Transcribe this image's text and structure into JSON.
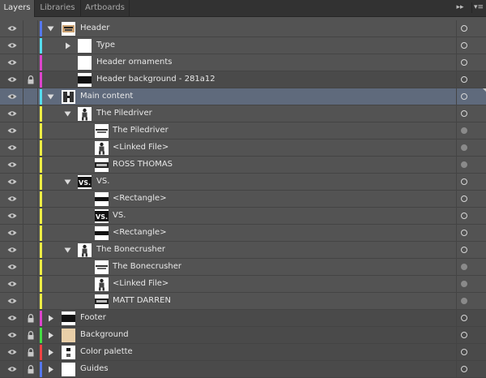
{
  "tabs": [
    "Layers",
    "Libraries",
    "Artboards"
  ],
  "layers": [
    {
      "name": "Header",
      "depth": 0,
      "color": "#5577ee",
      "expand": "open",
      "thumb": "header",
      "locked": false,
      "target_filled": false
    },
    {
      "name": "Type",
      "depth": 1,
      "color": "#55ddee",
      "expand": "closed",
      "thumb": "blank",
      "locked": false,
      "target_filled": false
    },
    {
      "name": "Header ornaments",
      "depth": 1,
      "color": "#dd44cc",
      "expand": "none",
      "thumb": "blank",
      "locked": false,
      "target_filled": false
    },
    {
      "name": "Header background - 281a12",
      "depth": 1,
      "color": "#dd44cc",
      "expand": "none",
      "thumb": "band",
      "locked": true,
      "target_filled": false
    },
    {
      "name": "Main content",
      "depth": 0,
      "color": "#55ddee",
      "expand": "open",
      "thumb": "main",
      "locked": false,
      "target_filled": false,
      "selected": true
    },
    {
      "name": "The Piledriver",
      "depth": 1,
      "color": "#eeee44",
      "expand": "open",
      "thumb": "figure",
      "locked": false,
      "target_filled": false
    },
    {
      "name": "The Piledriver",
      "depth": 2,
      "color": "#eeee44",
      "expand": "none",
      "thumb": "title",
      "locked": false,
      "target_filled": true
    },
    {
      "name": "<Linked File>",
      "depth": 2,
      "color": "#eeee44",
      "expand": "none",
      "thumb": "figure",
      "locked": false,
      "target_filled": true
    },
    {
      "name": "ROSS THOMAS",
      "depth": 2,
      "color": "#eeee44",
      "expand": "none",
      "thumb": "name",
      "locked": false,
      "target_filled": true
    },
    {
      "name": "VS.",
      "depth": 1,
      "color": "#eeee44",
      "expand": "open",
      "thumb": "vs",
      "locked": false,
      "target_filled": false
    },
    {
      "name": "<Rectangle>",
      "depth": 2,
      "color": "#eeee44",
      "expand": "none",
      "thumb": "rect",
      "locked": false,
      "target_filled": false
    },
    {
      "name": "VS.",
      "depth": 2,
      "color": "#eeee44",
      "expand": "none",
      "thumb": "vs",
      "locked": false,
      "target_filled": false
    },
    {
      "name": "<Rectangle>",
      "depth": 2,
      "color": "#eeee44",
      "expand": "none",
      "thumb": "rect",
      "locked": false,
      "target_filled": false
    },
    {
      "name": "The Bonecrusher",
      "depth": 1,
      "color": "#eeee44",
      "expand": "open",
      "thumb": "figure",
      "locked": false,
      "target_filled": false
    },
    {
      "name": "The Bonecrusher",
      "depth": 2,
      "color": "#eeee44",
      "expand": "none",
      "thumb": "title",
      "locked": false,
      "target_filled": true
    },
    {
      "name": "<Linked File>",
      "depth": 2,
      "color": "#eeee44",
      "expand": "none",
      "thumb": "figure",
      "locked": false,
      "target_filled": true
    },
    {
      "name": "MATT DARREN",
      "depth": 2,
      "color": "#eeee44",
      "expand": "none",
      "thumb": "name",
      "locked": false,
      "target_filled": true
    },
    {
      "name": "Footer",
      "depth": 0,
      "color": "#dd44cc",
      "expand": "closed",
      "thumb": "band",
      "locked": true,
      "target_filled": false
    },
    {
      "name": "Background",
      "depth": 0,
      "color": "#44dd44",
      "expand": "closed",
      "thumb": "beige",
      "locked": true,
      "target_filled": false
    },
    {
      "name": "Color palette",
      "depth": 0,
      "color": "#ee4444",
      "expand": "closed",
      "thumb": "palette",
      "locked": true,
      "target_filled": false
    },
    {
      "name": "Guides",
      "depth": 0,
      "color": "#5577ee",
      "expand": "closed",
      "thumb": "blank",
      "locked": true,
      "target_filled": false
    }
  ]
}
